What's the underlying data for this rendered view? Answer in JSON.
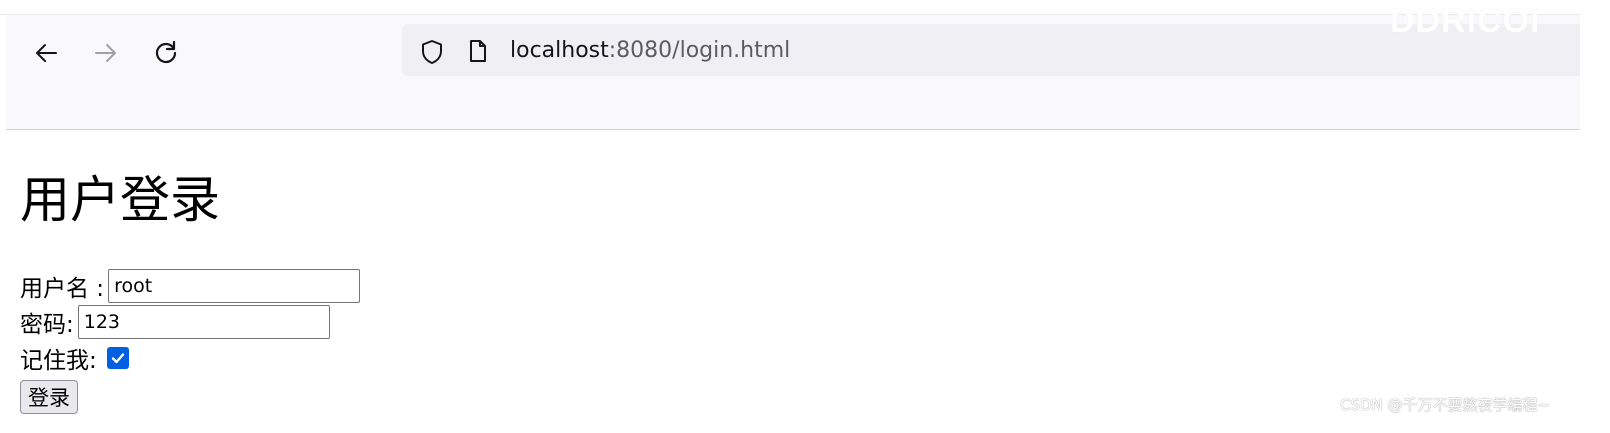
{
  "browser": {
    "url": {
      "host": "localhost",
      "rest": ":8080/login.html"
    },
    "icons": {
      "back": "arrow-left-icon",
      "forward": "arrow-right-icon",
      "reload": "reload-icon",
      "tracking_protection": "shield-icon",
      "page_info": "page-icon"
    },
    "watermark": "DDRICOI"
  },
  "page": {
    "title": "用户登录",
    "form": {
      "username_label": "用户名 :",
      "username_value": "root",
      "password_label": "密码:",
      "password_value": "123",
      "remember_label": "记住我:",
      "remember_checked": true,
      "submit_label": "登录"
    },
    "watermark": "CSDN @千万不要熬夜学编程~"
  },
  "colors": {
    "checkbox_accent": "#0060df",
    "toolbar_bg": "#f9f9fb",
    "urlbar_bg": "#f0f0f4"
  }
}
